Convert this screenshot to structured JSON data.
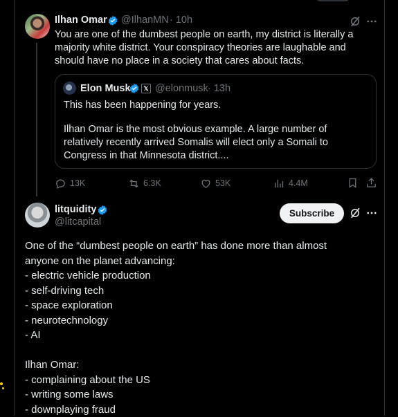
{
  "tweet": {
    "author_name": "Ilhan Omar",
    "handle": "@IlhanMN",
    "time": "· 10h",
    "text": "You are one of the dumbest people on earth, my district is literally a majority white district. Your conspiracy theories are laughable and should have no place in a society that cares about facts.",
    "quote": {
      "author_name": "Elon Musk",
      "affiliate_badge": "𝕏",
      "handle": "@elonmusk",
      "time": "· 13h",
      "line1": "This has been happening for years.",
      "line2": "Ilhan Omar is the most obvious example. A large number of relatively recently arrived Somalis will elect only a Somali to Congress in that Minnesota district...."
    },
    "actions": {
      "replies": "13K",
      "reposts": "6.3K",
      "likes": "53K",
      "views": "4.4M"
    }
  },
  "reply": {
    "author_name": "litquidity",
    "handle": "@litcapital",
    "subscribe_label": "Subscribe",
    "lines": [
      "One of the “dumbest people on earth” has done more than almost",
      "anyone on the planet advancing:",
      "- electric vehicle production",
      "- self-driving tech",
      "- space exploration",
      "- neurotechnology",
      "- AI",
      "",
      "Ilhan Omar:",
      "- complaining about the US",
      "- writing some laws",
      "- downplaying fraud"
    ]
  },
  "icons": {
    "grok": "grok-icon",
    "more": "more-icon",
    "verified": "verified-badge-icon",
    "reply": "reply-icon",
    "repost": "repost-icon",
    "like": "heart-icon",
    "views": "views-icon",
    "bookmark": "bookmark-icon",
    "share": "share-icon"
  },
  "colors": {
    "background": "#000000",
    "text": "#e7e9ea",
    "muted": "#71767b",
    "verified": "#1d9bf0",
    "border": "#2f3336"
  }
}
